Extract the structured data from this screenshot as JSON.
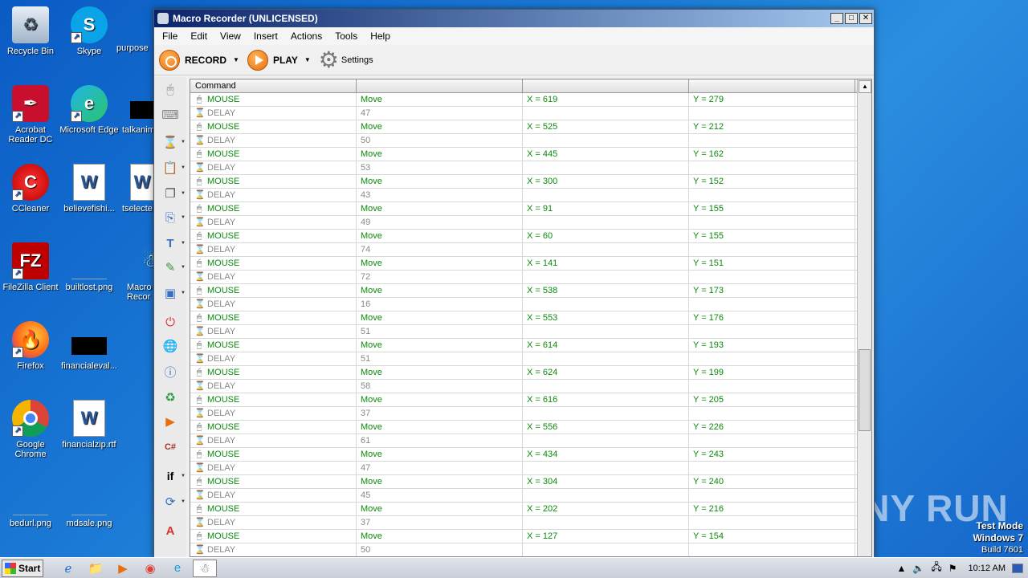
{
  "desktop": {
    "icons": [
      {
        "label": "Recycle Bin",
        "glyph": "recycle-bin-icon"
      },
      {
        "label": "Skype",
        "glyph": "skype-icon"
      },
      {
        "label": "purpose",
        "glyph": "file-icon"
      },
      {
        "label": "Acrobat Reader DC",
        "glyph": "acrobat-icon"
      },
      {
        "label": "Microsoft Edge",
        "glyph": "edge-icon"
      },
      {
        "label": "talkanim",
        "glyph": "file-icon"
      },
      {
        "label": "CCleaner",
        "glyph": "ccleaner-icon"
      },
      {
        "label": "believefishi...",
        "glyph": "word-icon"
      },
      {
        "label": "tselecte",
        "glyph": "word-icon"
      },
      {
        "label": "FileZilla Client",
        "glyph": "filezilla-icon"
      },
      {
        "label": "builtlost.png",
        "glyph": "image-icon"
      },
      {
        "label": "Macro Recor",
        "glyph": "macro-icon"
      },
      {
        "label": "Firefox",
        "glyph": "firefox-icon"
      },
      {
        "label": "financialeval...",
        "glyph": "file-icon"
      },
      {
        "label": "Google Chrome",
        "glyph": "chrome-icon"
      },
      {
        "label": "financialzip.rtf",
        "glyph": "word-icon"
      },
      {
        "label": "bedurl.png",
        "glyph": "image-icon"
      },
      {
        "label": "mdsale.png",
        "glyph": "image-icon"
      }
    ],
    "watermark": "ANY RUN",
    "os_info": {
      "line1": "Test Mode",
      "line2": "Windows 7",
      "line3": "Build 7601"
    }
  },
  "window": {
    "title": "Macro Recorder (UNLICENSED)",
    "menu": [
      "File",
      "Edit",
      "View",
      "Insert",
      "Actions",
      "Tools",
      "Help"
    ],
    "toolbar": {
      "record": "RECORD",
      "play": "PLAY",
      "settings": "Settings"
    },
    "grid": {
      "headers": [
        "Command",
        "",
        "",
        ""
      ],
      "rows": [
        {
          "type": "mouse",
          "cmd": "MOUSE",
          "action": "Move",
          "x": "X = 619",
          "y": "Y = 279"
        },
        {
          "type": "delay",
          "cmd": "DELAY",
          "action": "47",
          "x": "",
          "y": ""
        },
        {
          "type": "mouse",
          "cmd": "MOUSE",
          "action": "Move",
          "x": "X = 525",
          "y": "Y = 212"
        },
        {
          "type": "delay",
          "cmd": "DELAY",
          "action": "50",
          "x": "",
          "y": ""
        },
        {
          "type": "mouse",
          "cmd": "MOUSE",
          "action": "Move",
          "x": "X = 445",
          "y": "Y = 162"
        },
        {
          "type": "delay",
          "cmd": "DELAY",
          "action": "53",
          "x": "",
          "y": ""
        },
        {
          "type": "mouse",
          "cmd": "MOUSE",
          "action": "Move",
          "x": "X = 300",
          "y": "Y = 152"
        },
        {
          "type": "delay",
          "cmd": "DELAY",
          "action": "43",
          "x": "",
          "y": ""
        },
        {
          "type": "mouse",
          "cmd": "MOUSE",
          "action": "Move",
          "x": "X = 91",
          "y": "Y = 155"
        },
        {
          "type": "delay",
          "cmd": "DELAY",
          "action": "49",
          "x": "",
          "y": ""
        },
        {
          "type": "mouse",
          "cmd": "MOUSE",
          "action": "Move",
          "x": "X = 60",
          "y": "Y = 155"
        },
        {
          "type": "delay",
          "cmd": "DELAY",
          "action": "74",
          "x": "",
          "y": ""
        },
        {
          "type": "mouse",
          "cmd": "MOUSE",
          "action": "Move",
          "x": "X = 141",
          "y": "Y = 151"
        },
        {
          "type": "delay",
          "cmd": "DELAY",
          "action": "72",
          "x": "",
          "y": ""
        },
        {
          "type": "mouse",
          "cmd": "MOUSE",
          "action": "Move",
          "x": "X = 538",
          "y": "Y = 173"
        },
        {
          "type": "delay",
          "cmd": "DELAY",
          "action": "16",
          "x": "",
          "y": ""
        },
        {
          "type": "mouse",
          "cmd": "MOUSE",
          "action": "Move",
          "x": "X = 553",
          "y": "Y = 176"
        },
        {
          "type": "delay",
          "cmd": "DELAY",
          "action": "51",
          "x": "",
          "y": ""
        },
        {
          "type": "mouse",
          "cmd": "MOUSE",
          "action": "Move",
          "x": "X = 614",
          "y": "Y = 193"
        },
        {
          "type": "delay",
          "cmd": "DELAY",
          "action": "51",
          "x": "",
          "y": ""
        },
        {
          "type": "mouse",
          "cmd": "MOUSE",
          "action": "Move",
          "x": "X = 624",
          "y": "Y = 199"
        },
        {
          "type": "delay",
          "cmd": "DELAY",
          "action": "58",
          "x": "",
          "y": ""
        },
        {
          "type": "mouse",
          "cmd": "MOUSE",
          "action": "Move",
          "x": "X = 616",
          "y": "Y = 205"
        },
        {
          "type": "delay",
          "cmd": "DELAY",
          "action": "37",
          "x": "",
          "y": ""
        },
        {
          "type": "mouse",
          "cmd": "MOUSE",
          "action": "Move",
          "x": "X = 556",
          "y": "Y = 226"
        },
        {
          "type": "delay",
          "cmd": "DELAY",
          "action": "61",
          "x": "",
          "y": ""
        },
        {
          "type": "mouse",
          "cmd": "MOUSE",
          "action": "Move",
          "x": "X = 434",
          "y": "Y = 243"
        },
        {
          "type": "delay",
          "cmd": "DELAY",
          "action": "47",
          "x": "",
          "y": ""
        },
        {
          "type": "mouse",
          "cmd": "MOUSE",
          "action": "Move",
          "x": "X = 304",
          "y": "Y = 240"
        },
        {
          "type": "delay",
          "cmd": "DELAY",
          "action": "45",
          "x": "",
          "y": ""
        },
        {
          "type": "mouse",
          "cmd": "MOUSE",
          "action": "Move",
          "x": "X = 202",
          "y": "Y = 216"
        },
        {
          "type": "delay",
          "cmd": "DELAY",
          "action": "37",
          "x": "",
          "y": ""
        },
        {
          "type": "mouse",
          "cmd": "MOUSE",
          "action": "Move",
          "x": "X = 127",
          "y": "Y = 154"
        },
        {
          "type": "delay",
          "cmd": "DELAY",
          "action": "50",
          "x": "",
          "y": ""
        }
      ]
    },
    "palette": [
      "mouse-icon",
      "keyboard-icon",
      "hourglass-icon",
      "clipboard-icon",
      "window-icon",
      "copy-icon",
      "text-icon",
      "eyedropper-icon",
      "image-icon",
      "stop-icon",
      "globe-icon",
      "info-icon",
      "refresh-globe-icon",
      "play-icon",
      "csharp-icon",
      "if-icon",
      "loop-icon",
      "font-icon"
    ]
  },
  "taskbar": {
    "start": "Start",
    "clock": "10:12 AM"
  },
  "colors": {
    "mouse_text": "#0b8a0b",
    "delay_text": "#888888",
    "accent": "#e86d0c"
  }
}
